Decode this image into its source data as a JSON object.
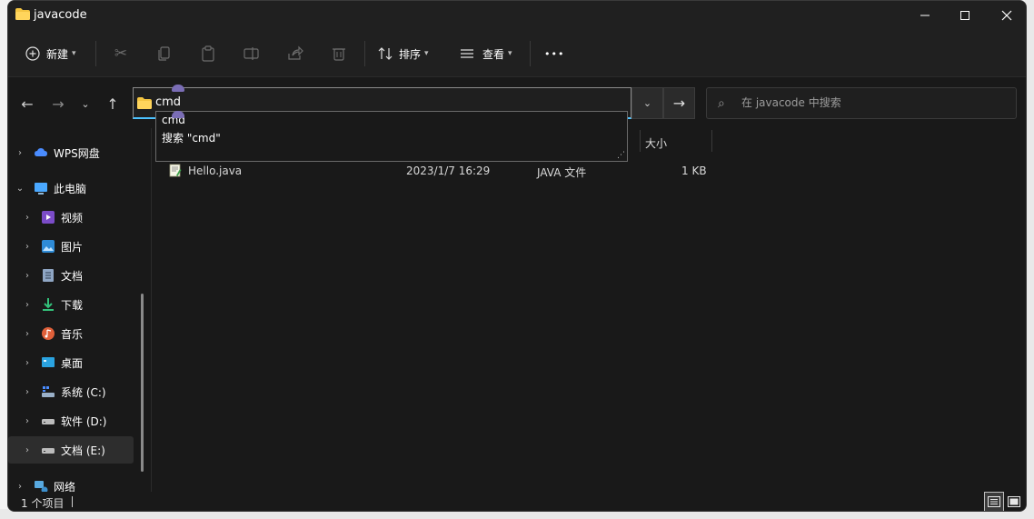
{
  "window": {
    "title": "javacode"
  },
  "toolbar": {
    "new_label": "新建",
    "sort_label": "排序",
    "view_label": "查看",
    "more_label": "•••"
  },
  "address": {
    "value": "cmd"
  },
  "search": {
    "placeholder": "在 javacode 中搜索"
  },
  "autocomplete": {
    "items": [
      "cmd",
      "搜索 \"cmd\""
    ]
  },
  "sidebar": {
    "items": [
      {
        "label": "WPS网盘",
        "icon": "cloud-icon",
        "color": "#4a8cff"
      },
      {
        "label": "此电脑",
        "icon": "computer-icon",
        "color": "#4aa8ff"
      },
      {
        "label": "视频",
        "icon": "video-icon",
        "color": "#7b4cc8"
      },
      {
        "label": "图片",
        "icon": "picture-icon",
        "color": "#2e8bd6"
      },
      {
        "label": "文档",
        "icon": "document-icon",
        "color": "#8fa6c4"
      },
      {
        "label": "下载",
        "icon": "download-icon",
        "color": "#33c17a"
      },
      {
        "label": "音乐",
        "icon": "music-icon",
        "color": "#e0603a"
      },
      {
        "label": "桌面",
        "icon": "desktop-icon",
        "color": "#2aa3e0"
      },
      {
        "label": "系统 (C:)",
        "icon": "system-drive-icon",
        "color": "#9ab0c8"
      },
      {
        "label": "软件 (D:)",
        "icon": "drive-icon",
        "color": "#bcbcbc"
      },
      {
        "label": "文档 (E:)",
        "icon": "drive-icon",
        "color": "#bcbcbc"
      },
      {
        "label": "网络",
        "icon": "network-icon",
        "color": "#58a9e0"
      }
    ]
  },
  "content": {
    "columns": {
      "size": "大小"
    },
    "files": [
      {
        "name": "Hello.java",
        "modified": "2023/1/7 16:29",
        "type": "JAVA 文件",
        "size": "1 KB"
      }
    ]
  },
  "status": {
    "item_count": "1 个项目"
  },
  "colors": {
    "accent": "#4cc2ff",
    "folder": "#f4c542",
    "background": "#191919"
  }
}
